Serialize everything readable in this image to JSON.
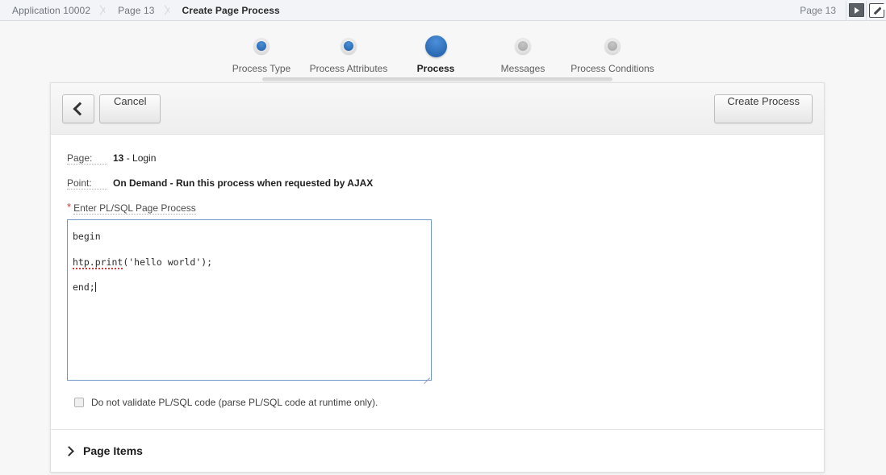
{
  "header": {
    "breadcrumb": [
      {
        "label": "Application 10002",
        "current": false
      },
      {
        "label": "Page 13",
        "current": false
      },
      {
        "label": "Create Page Process",
        "current": true
      }
    ],
    "page_label": "Page 13",
    "run_icon": "play-icon",
    "edit_icon": "pencil-edit-icon"
  },
  "wizard": {
    "steps": [
      {
        "label": "Process Type",
        "state": "done"
      },
      {
        "label": "Process Attributes",
        "state": "done"
      },
      {
        "label": "Process",
        "state": "current"
      },
      {
        "label": "Messages",
        "state": "future"
      },
      {
        "label": "Process Conditions",
        "state": "future"
      }
    ]
  },
  "toolbar": {
    "back_icon": "chevron-left-icon",
    "cancel_label": "Cancel",
    "create_label": "Create Process"
  },
  "form": {
    "page_field": {
      "label": "Page:",
      "value_bold": "13",
      "value_rest": " - Login"
    },
    "point_field": {
      "label": "Point:",
      "value_bold": "On Demand",
      "value_rest": " - Run this process when requested by AJAX"
    },
    "plsql": {
      "required_marker": "*",
      "label": "Enter PL/SQL Page Process",
      "line1": "begin",
      "line2_err": "htp.print",
      "line2_rest": "('hello world');",
      "line3": "end;"
    },
    "checkbox": {
      "checked": false,
      "label": "Do not validate PL/SQL code (parse PL/SQL code at runtime only)."
    }
  },
  "page_items": {
    "chevron_icon": "chevron-right-icon",
    "title": "Page Items"
  },
  "colors": {
    "accent_blue": "#1f5fa8",
    "required_red": "#d03a3a",
    "focus_border": "#7196c8",
    "header_bg": "#f2f4f8"
  }
}
